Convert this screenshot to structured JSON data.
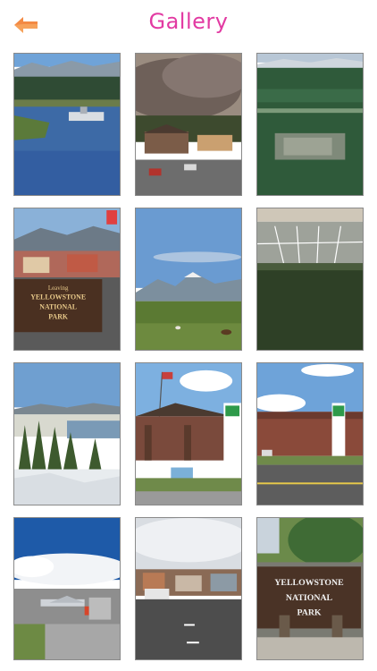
{
  "header": {
    "title": "Gallery",
    "back_icon": "back-arrow-icon"
  },
  "colors": {
    "title": "#e23aa2",
    "back_arrow": "#f6a25b",
    "accent_orange": "#f6a25b"
  },
  "gallery": {
    "tiles": [
      {
        "name": "photo-river-boats"
      },
      {
        "name": "photo-smoke-town"
      },
      {
        "name": "photo-aerial-forest-town"
      },
      {
        "name": "photo-yellowstone-sign-town",
        "sign_text": "Leaving YELLOWSTONE NATIONAL PARK"
      },
      {
        "name": "photo-mountain-pasture"
      },
      {
        "name": "photo-aerial-town-grid"
      },
      {
        "name": "photo-lake-trees"
      },
      {
        "name": "photo-lodge-entrance"
      },
      {
        "name": "photo-holiday-inn"
      },
      {
        "name": "photo-airport"
      },
      {
        "name": "photo-main-street"
      },
      {
        "name": "photo-park-sign",
        "sign_text": "YELLOWSTONE NATIONAL PARK"
      }
    ]
  }
}
